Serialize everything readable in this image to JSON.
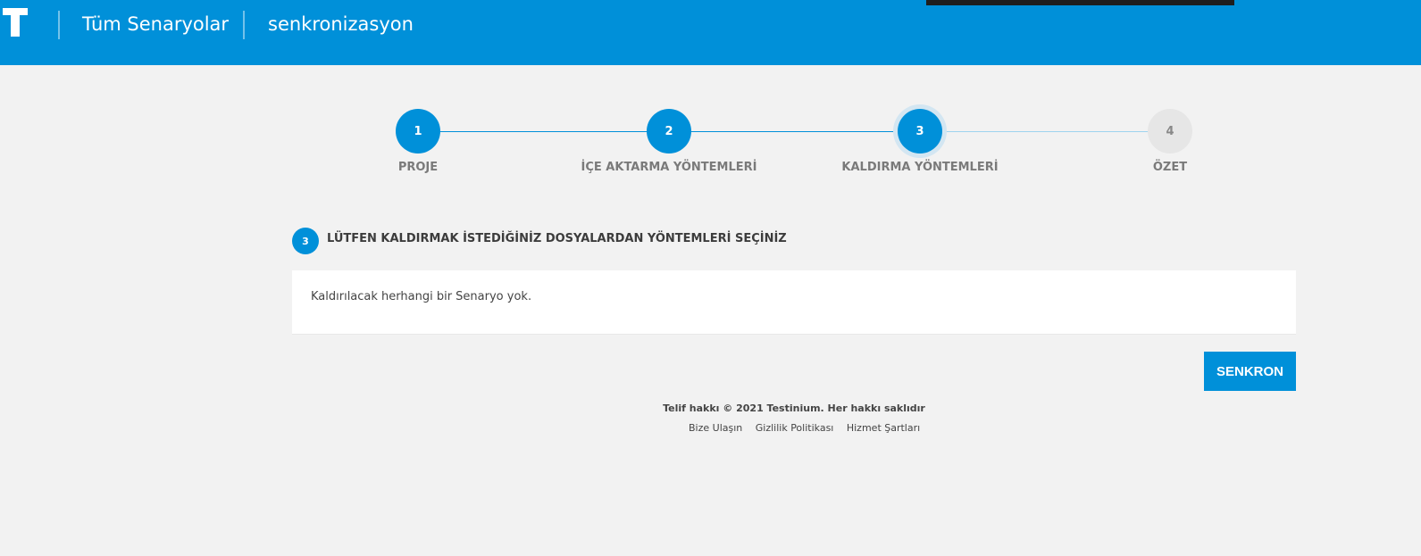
{
  "header": {
    "logo_letter": "T",
    "crumb_all": "Tüm Senaryolar",
    "crumb_current": "senkronizasyon",
    "bg_color": "#0090d9"
  },
  "stepper": {
    "steps": [
      {
        "number": "1",
        "label": "PROJE",
        "state": "done"
      },
      {
        "number": "2",
        "label": "İÇE AKTARMA YÖNTEMLERİ",
        "state": "done"
      },
      {
        "number": "3",
        "label": "KALDIRMA YÖNTEMLERİ",
        "state": "active"
      },
      {
        "number": "4",
        "label": "ÖZET",
        "state": "todo"
      }
    ]
  },
  "section": {
    "badge": "3",
    "title": "LÜTFEN KALDIRMAK İSTEDİĞİNİZ DOSYALARDAN YÖNTEMLERİ SEÇİNİZ",
    "message": "Kaldırılacak herhangi bir Senaryo yok."
  },
  "actions": {
    "sync_label": "SENKRON"
  },
  "footer": {
    "copyright": "Telif hakkı © 2021 Testinium. Her hakkı saklıdır",
    "links": [
      "Bize Ulaşın",
      "Gizlilik Politikası",
      "Hizmet Şartları"
    ]
  }
}
